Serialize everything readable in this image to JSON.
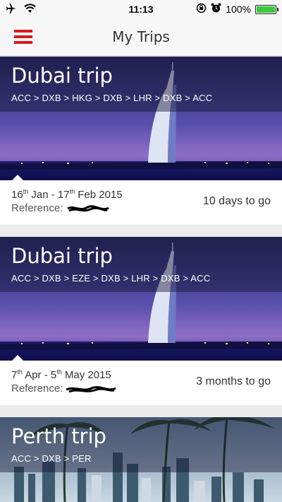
{
  "status_bar": {
    "time": "11:13",
    "battery": "100%",
    "battery_level": 1.0
  },
  "nav": {
    "title": "My Trips",
    "menu_icon": "hamburger-menu-icon"
  },
  "trips": [
    {
      "title": "Dubai trip",
      "route": "ACC > DXB > HKG > DXB > LHR > DXB > ACC",
      "date_start_day": "16",
      "date_start_suffix": "th",
      "date_start_rest": " Jan - ",
      "date_end_day": "17",
      "date_end_suffix": "th",
      "date_end_rest": " Feb 2015",
      "reference_label": "Reference:",
      "countdown": "10 days to go"
    },
    {
      "title": "Dubai trip",
      "route": "ACC > DXB > EZE > DXB > LHR > DXB > ACC",
      "date_start_day": "7",
      "date_start_suffix": "th",
      "date_start_rest": " Apr - ",
      "date_end_day": "5",
      "date_end_suffix": "th",
      "date_end_rest": " May 2015",
      "reference_label": "Reference:",
      "countdown": "3 months to go"
    },
    {
      "title": "Perth trip",
      "route": "ACC > DXB > PER"
    }
  ],
  "colors": {
    "accent": "#d71920",
    "battery": "#3cc93c"
  }
}
